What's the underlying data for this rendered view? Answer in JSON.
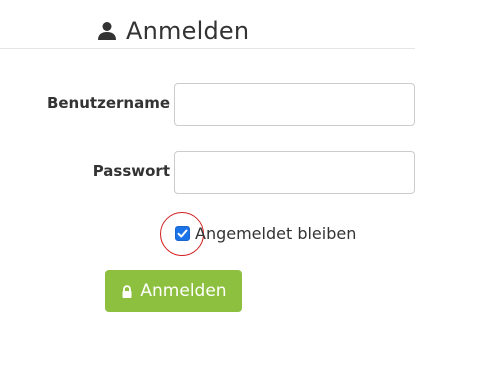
{
  "header": {
    "title": "Anmelden",
    "icon": "user-icon"
  },
  "form": {
    "username_label": "Benutzername",
    "username_value": "",
    "password_label": "Passwort",
    "password_value": "",
    "remember_label": "Angemeldet bleiben",
    "remember_checked": true,
    "submit_label": "Anmelden",
    "submit_icon": "lock-icon"
  },
  "colors": {
    "accent": "#8DC03F",
    "checkbox": "#1A73E8",
    "highlight": "#D21F1F",
    "text": "#333333"
  }
}
